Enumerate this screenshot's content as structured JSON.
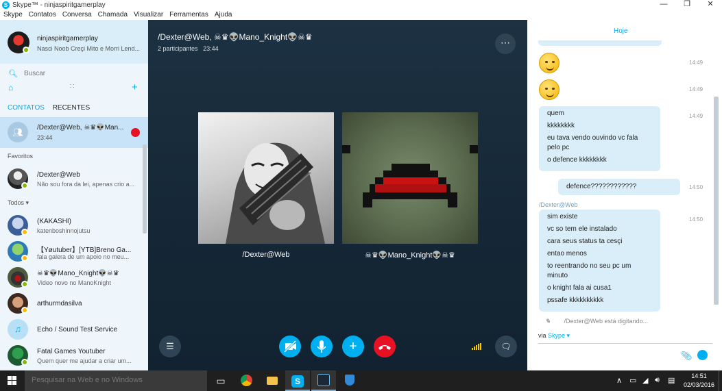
{
  "window": {
    "title": "Skype™ - ninjaspiritgamerplay",
    "icon": "skype-icon"
  },
  "window_controls": {
    "minimize": "—",
    "maximize": "❐",
    "close": "✕"
  },
  "menu": [
    "Skype",
    "Contatos",
    "Conversa",
    "Chamada",
    "Visualizar",
    "Ferramentas",
    "Ajuda"
  ],
  "profile": {
    "name": "ninjaspiritgamerplay",
    "mood": "Nasci Noob Creçi Mito e Morri Lend...",
    "status_color": "#7fba00"
  },
  "search": {
    "placeholder": "Buscar"
  },
  "tabs": {
    "contacts": "CONTATOS",
    "recent": "RECENTES"
  },
  "active_conversation": {
    "name": "/Dexter@Web, ☠♛👽Man...",
    "time": "23:44"
  },
  "sections": {
    "favorites": "Favoritos",
    "all": "Todos ▾"
  },
  "favorites": [
    {
      "name": "/Dexter@Web",
      "mood": "Não sou fora da lei, apenas crio a..."
    }
  ],
  "contacts": [
    {
      "name": "(KAKASHI)",
      "mood": "katenboshinnojutsu"
    },
    {
      "name": "【Yøutuber】[YTB]Breno Ga...",
      "mood": "fala galera de um apoio no meu..."
    },
    {
      "name": "☠♛👽Mano_Knight👽☠♛",
      "mood": "Video novo no ManoKnight"
    },
    {
      "name": "arthurmdasilva",
      "mood": ""
    },
    {
      "name": "Echo / Sound Test Service",
      "mood": ""
    },
    {
      "name": "Fatal Games Youtuber",
      "mood": "Quem quer me ajudar a criar um..."
    }
  ],
  "call": {
    "title": "/Dexter@Web, ☠♛👽Mano_Knight👽☠♛",
    "participants": "2 participantes",
    "duration": "23:44",
    "participant_1": "/Dexter@Web",
    "participant_2": "☠♛👽Mano_Knight👽☠♛",
    "colors": {
      "control_blue": "#00aff0",
      "end_red": "#e81123",
      "signal": "#f6c90e"
    }
  },
  "chat": {
    "date": "Hoje",
    "messages": {
      "m1_time": "14:49",
      "m2_time": "14:49",
      "m3_time": "14:49",
      "m3_lines": [
        "quem",
        "kkkkkkkk",
        "eu tava vendo ouvindo vc fala",
        "pelo pc",
        "o defence kkkkkkkk"
      ],
      "m4_time": "14:50",
      "m4_text": "defence????????????",
      "sender": "/Dexter@Web",
      "m5_time": "14:50",
      "m5_lines": [
        "sim existe",
        "vc so tem ele instalado",
        "cara seus status ta cesçi",
        "entao menos",
        "to reentrando no seu pc um",
        "minuto",
        "o knight fala ai cusa1",
        "pssafe kkkkkkkkkk"
      ]
    },
    "typing": "/Dexter@Web está digitando...",
    "via_label": "via",
    "via_service": "Skype ▾",
    "input_value": ""
  },
  "taskbar": {
    "search_placeholder": "Pesquisar na Web e no Windows",
    "apps": [
      "task-view-icon",
      "chrome-icon",
      "file-explorer-icon",
      "skype-icon",
      "steam-icon",
      "shield-icon"
    ],
    "time": "14:51",
    "date": "02/03/2016"
  }
}
